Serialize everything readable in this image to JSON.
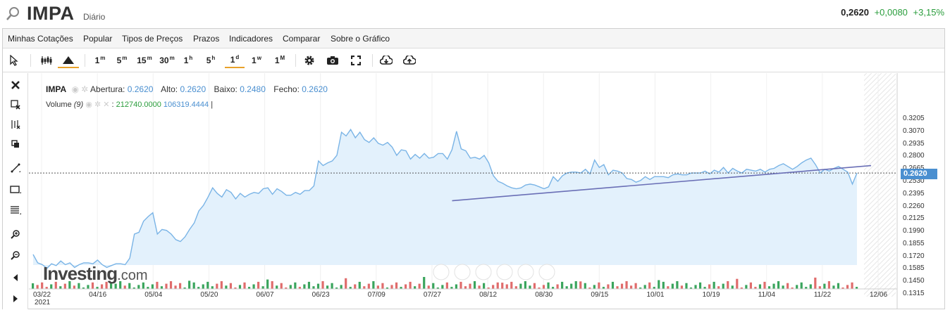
{
  "header": {
    "symbol": "IMPA",
    "period": "Diário",
    "last": "0,2620",
    "change": "+0,0080",
    "change_pct": "+3,15%",
    "up_color": "#2a9d3c"
  },
  "menu": [
    "Minhas Cotações",
    "Popular",
    "Tipos de Preços",
    "Prazos",
    "Indicadores",
    "Comparar",
    "Sobre o Gráfico"
  ],
  "toolbar": {
    "tools": [
      {
        "name": "cursor-icon"
      },
      {
        "name": "candles-icon"
      },
      {
        "name": "area-chart-icon",
        "active": true
      }
    ],
    "intervals": [
      {
        "n": "1",
        "u": "m"
      },
      {
        "n": "5",
        "u": "m"
      },
      {
        "n": "15",
        "u": "m"
      },
      {
        "n": "30",
        "u": "m"
      },
      {
        "n": "1",
        "u": "h"
      },
      {
        "n": "5",
        "u": "h"
      },
      {
        "n": "1",
        "u": "d",
        "active": true
      },
      {
        "n": "1",
        "u": "w"
      },
      {
        "n": "1",
        "u": "M"
      }
    ],
    "actions": [
      "gear-icon",
      "camera-icon",
      "fullscreen-icon",
      "download-icon",
      "upload-icon"
    ],
    "accent": "#e8a12a"
  },
  "left_tools": [
    "close-icon",
    "crosshair-delete-icon",
    "pattern-icon",
    "copy-icon",
    "trendline-icon",
    "rectangle-icon",
    "fibonacci-icon",
    "zoom-in-icon",
    "zoom-out-icon",
    "scroll-left-icon",
    "scroll-right-icon"
  ],
  "legend": {
    "symbol": "IMPA",
    "open_label": "Abertura:",
    "open": "0.2620",
    "high_label": "Alto:",
    "high": "0.2620",
    "low_label": "Baixo:",
    "low": "0.2480",
    "close_label": "Fecho:",
    "close": "0.2620",
    "volume_label": "Volume",
    "volume_param": "(9)",
    "vol1": "212740.0000",
    "vol2": "106319.4444",
    "sep": "|"
  },
  "watermark": {
    "main": "Investing",
    "dom": ".com"
  },
  "chart_data": {
    "type": "area",
    "x_labels": [
      "03/22",
      "04/16",
      "05/04",
      "05/20",
      "06/07",
      "06/23",
      "07/09",
      "07/27",
      "08/12",
      "08/30",
      "09/15",
      "10/01",
      "10/19",
      "11/04",
      "11/22",
      "12/06"
    ],
    "year_label": "2021",
    "y_ticks": [
      "0.3205",
      "0.3070",
      "0.2935",
      "0.2800",
      "0.2665",
      "0.2530",
      "0.2395",
      "0.2260",
      "0.2125",
      "0.1990",
      "0.1855",
      "0.1720",
      "0.1585",
      "0.1450",
      "0.1315"
    ],
    "ylim": [
      0.1315,
      0.3205
    ],
    "current_price": "0.2620",
    "series_close": [
      0.174,
      0.165,
      0.163,
      0.159,
      0.164,
      0.162,
      0.167,
      0.163,
      0.165,
      0.16,
      0.163,
      0.165,
      0.165,
      0.164,
      0.168,
      0.163,
      0.16,
      0.162,
      0.164,
      0.164,
      0.163,
      0.17,
      0.196,
      0.198,
      0.21,
      0.215,
      0.219,
      0.196,
      0.201,
      0.2,
      0.196,
      0.19,
      0.188,
      0.193,
      0.201,
      0.208,
      0.221,
      0.227,
      0.236,
      0.246,
      0.24,
      0.236,
      0.244,
      0.241,
      0.234,
      0.24,
      0.236,
      0.239,
      0.241,
      0.24,
      0.245,
      0.246,
      0.239,
      0.245,
      0.242,
      0.238,
      0.238,
      0.241,
      0.239,
      0.243,
      0.243,
      0.248,
      0.275,
      0.27,
      0.273,
      0.275,
      0.281,
      0.306,
      0.302,
      0.309,
      0.3,
      0.306,
      0.298,
      0.295,
      0.3,
      0.294,
      0.292,
      0.295,
      0.29,
      0.281,
      0.287,
      0.286,
      0.277,
      0.282,
      0.278,
      0.283,
      0.278,
      0.279,
      0.283,
      0.283,
      0.277,
      0.287,
      0.307,
      0.288,
      0.286,
      0.278,
      0.279,
      0.277,
      0.281,
      0.273,
      0.259,
      0.253,
      0.251,
      0.248,
      0.246,
      0.245,
      0.246,
      0.249,
      0.25,
      0.249,
      0.247,
      0.245,
      0.247,
      0.258,
      0.253,
      0.259,
      0.262,
      0.263,
      0.263,
      0.262,
      0.266,
      0.261,
      0.276,
      0.268,
      0.271,
      0.26,
      0.265,
      0.264,
      0.262,
      0.256,
      0.255,
      0.252,
      0.254,
      0.258,
      0.255,
      0.258,
      0.258,
      0.258,
      0.257,
      0.26,
      0.261,
      0.26,
      0.26,
      0.262,
      0.262,
      0.262,
      0.264,
      0.261,
      0.265,
      0.263,
      0.268,
      0.262,
      0.267,
      0.264,
      0.262,
      0.266,
      0.265,
      0.264,
      0.266,
      0.263,
      0.266,
      0.267,
      0.27,
      0.272,
      0.269,
      0.266,
      0.269,
      0.273,
      0.276,
      0.278,
      0.271,
      0.262,
      0.266,
      0.264,
      0.267,
      0.269,
      0.266,
      0.263,
      0.25,
      0.262
    ],
    "trendline": {
      "start": [
        0,
        0.232
      ],
      "end": [
        1,
        0.27
      ]
    },
    "volume_colors": {
      "up": "#3aa55d",
      "down": "#e06c6c"
    },
    "grid": true
  }
}
